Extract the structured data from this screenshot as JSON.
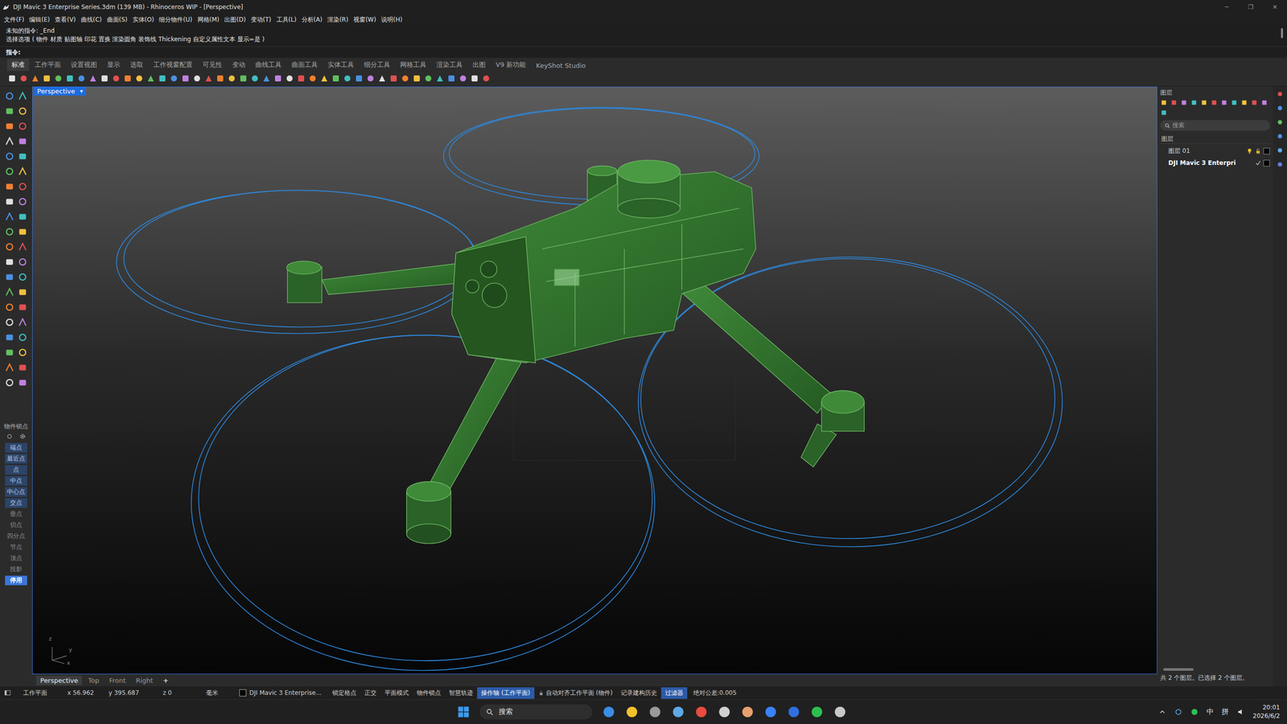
{
  "window": {
    "title": "DJI Mavic 3 Enterprise Series.3dm (139 MB) - Rhinoceros WIP - [Perspective]",
    "controls": [
      "─",
      "❐",
      "✕"
    ]
  },
  "menu": [
    "文件(F)",
    "编辑(E)",
    "查看(V)",
    "曲线(C)",
    "曲面(S)",
    "实体(O)",
    "细分物件(U)",
    "网格(M)",
    "出图(D)",
    "变动(T)",
    "工具(L)",
    "分析(A)",
    "渲染(R)",
    "视窗(W)",
    "说明(H)"
  ],
  "command": {
    "history": [
      "未知的指令: _End",
      "选择选项 ( 物件 材质 贴图轴 印花 置换 渲染圆角 装饰线 Thickening 自定义属性文本 显示=是 )"
    ],
    "prompt": "指令:"
  },
  "toolbar_tabs": [
    {
      "label": "标准",
      "selected": true
    },
    {
      "label": "工作平面",
      "selected": false
    },
    {
      "label": "设置视图",
      "selected": false
    },
    {
      "label": "显示",
      "selected": false
    },
    {
      "label": "选取",
      "selected": false
    },
    {
      "label": "工作视窗配置",
      "selected": false
    },
    {
      "label": "可见性",
      "selected": false
    },
    {
      "label": "变动",
      "selected": false
    },
    {
      "label": "曲线工具",
      "selected": false
    },
    {
      "label": "曲面工具",
      "selected": false
    },
    {
      "label": "实体工具",
      "selected": false
    },
    {
      "label": "细分工具",
      "selected": false
    },
    {
      "label": "网格工具",
      "selected": false
    },
    {
      "label": "渲染工具",
      "selected": false
    },
    {
      "label": "出图",
      "selected": false
    },
    {
      "label": "V9 新功能",
      "selected": false
    },
    {
      "label": "KeyShot Studio",
      "selected": false
    }
  ],
  "viewport": {
    "title": "Perspective",
    "menu_arrow": "▾",
    "axes": [
      "z",
      "y",
      "x"
    ]
  },
  "viewport_tabs": [
    {
      "label": "Perspective",
      "selected": true
    },
    {
      "label": "Top",
      "selected": false
    },
    {
      "label": "Front",
      "selected": false
    },
    {
      "label": "Right",
      "selected": false
    }
  ],
  "add_tab": "+",
  "osnap": {
    "title": "物件锁点",
    "items": [
      {
        "label": "端点",
        "checked": true
      },
      {
        "label": "最近点",
        "checked": true
      },
      {
        "label": "点",
        "checked": true
      },
      {
        "label": "中点",
        "checked": true
      },
      {
        "label": "中心点",
        "checked": true
      },
      {
        "label": "交点",
        "checked": true
      },
      {
        "label": "垂点",
        "checked": false
      },
      {
        "label": "切点",
        "checked": false
      },
      {
        "label": "四分点",
        "checked": false
      },
      {
        "label": "节点",
        "checked": false
      },
      {
        "label": "顶点",
        "checked": false
      },
      {
        "label": "投影",
        "checked": false
      }
    ],
    "disable": {
      "label": "停用",
      "on": true
    }
  },
  "layers": {
    "title": "图层",
    "search": "搜索",
    "column": "图层",
    "rows": [
      {
        "name": "图层 01",
        "current": false,
        "color": "#000000"
      },
      {
        "name": "DJI Mavic 3 Enterpri",
        "current": true,
        "color": "#000000"
      }
    ],
    "footer": "共 2 个图层。已选择 2 个图层。"
  },
  "status_bar": {
    "cplane": "工作平面",
    "coords": [
      "x 56.962",
      "y 395.687",
      "z 0"
    ],
    "units": "毫米",
    "layer": {
      "name": "DJI Mavic 3 Enterprise...",
      "color": "#000000"
    },
    "toggles": [
      {
        "label": "锁定格点",
        "on": false,
        "kind": "plain"
      },
      {
        "label": "正交",
        "on": false,
        "kind": "plain"
      },
      {
        "label": "平面模式",
        "on": false,
        "kind": "plain"
      },
      {
        "label": "物件锁点",
        "on": false,
        "kind": "plain"
      },
      {
        "label": "智慧轨迹",
        "on": false,
        "kind": "plain"
      },
      {
        "label": "操作轴 (工作平面)",
        "on": true,
        "kind": "plain"
      },
      {
        "label": "自动对齐工作平面 (物件)",
        "on": false,
        "kind": "locked"
      },
      {
        "label": "记录建构历史",
        "on": false,
        "kind": "plain"
      },
      {
        "label": "过滤器",
        "on": true,
        "kind": "plain"
      }
    ],
    "tolerance": "绝对公差:0.005"
  },
  "taskbar": {
    "search": "搜索",
    "tray": [
      "中",
      "拼"
    ],
    "time": "20:01",
    "date": "2026/6/2"
  }
}
